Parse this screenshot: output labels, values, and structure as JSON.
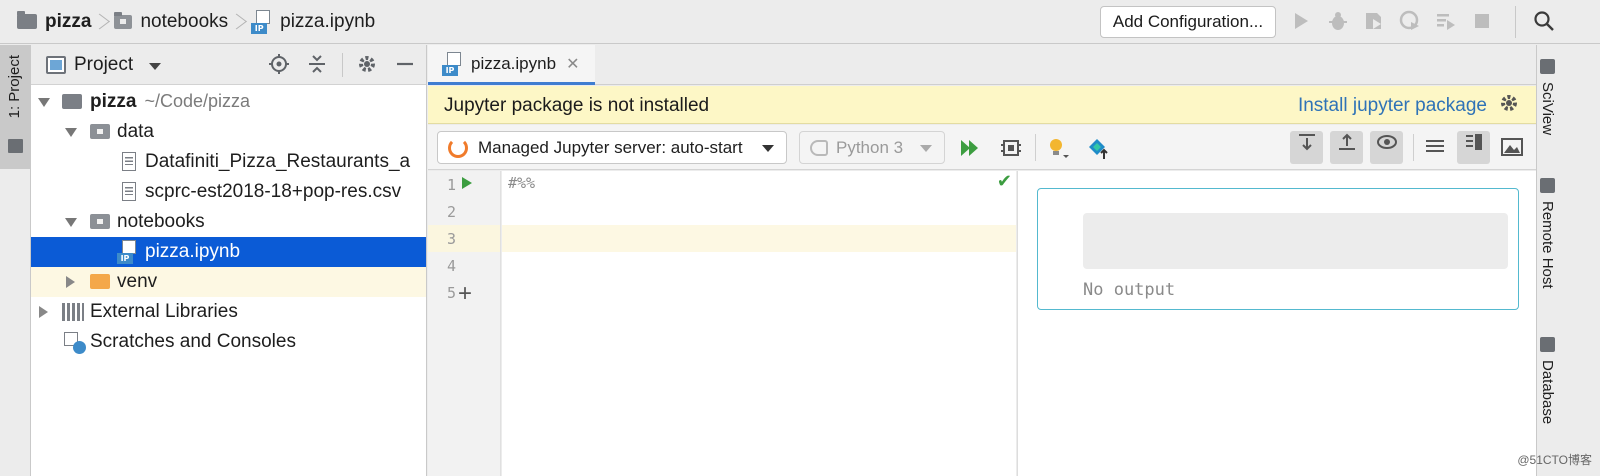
{
  "navbar": {
    "breadcrumbs": [
      "pizza",
      "notebooks",
      "pizza.ipynb"
    ],
    "add_config_label": "Add Configuration...",
    "toolbar_icons": [
      "run-icon",
      "debug-icon",
      "coverage-icon",
      "profile-icon",
      "concurrency-icon",
      "stop-icon",
      "search-icon"
    ]
  },
  "left_stripe": {
    "project_tab_label": "1: Project"
  },
  "project_panel": {
    "title": "Project",
    "tree": {
      "root_name": "pizza",
      "root_path": "~/Code/pizza",
      "data_folder": "data",
      "data_files": [
        "Datafiniti_Pizza_Restaurants_a",
        "scprc-est2018-18+pop-res.csv"
      ],
      "notebooks_folder": "notebooks",
      "notebook_file": "pizza.ipynb",
      "venv_folder": "venv",
      "external_libraries": "External Libraries",
      "scratches": "Scratches and Consoles"
    }
  },
  "editor": {
    "tab_label": "pizza.ipynb",
    "banner_message": "Jupyter package is not installed",
    "banner_link": "Install jupyter package",
    "server_select": "Managed Jupyter server: auto-start",
    "kernel_select": "Python 3",
    "line_numbers": [
      "1",
      "2",
      "3",
      "4",
      "5"
    ],
    "code_line1": "#%%",
    "output_text": "No output"
  },
  "right_stripe": {
    "tabs": [
      "SciView",
      "Remote Host",
      "Database"
    ]
  },
  "watermark": "@51CTO博客",
  "colors": {
    "selection": "#0b5bd6",
    "banner": "#fdf7c6",
    "link": "#2f73b7",
    "accent_cell": "#54b9cf",
    "run": "#3c9d40"
  }
}
